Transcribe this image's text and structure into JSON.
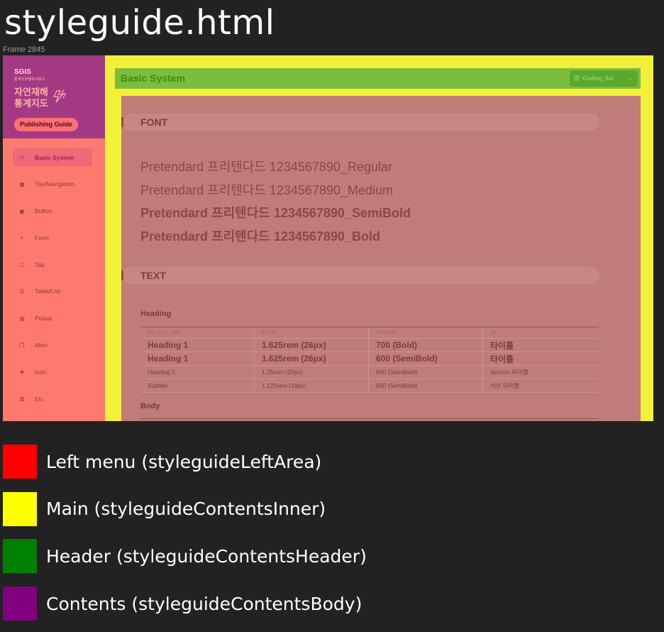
{
  "page": {
    "heading": "styleguide.html",
    "frame_label": "Frame 2845"
  },
  "left": {
    "brand": "SGIS",
    "brand_sub": "통계지리정보서비스",
    "app_title_line1": "자연재해",
    "app_title_line2": "통계지도",
    "publishing_button": "Publishing Guide",
    "menu": [
      {
        "label": "Basic System",
        "icon": "monitor-icon",
        "glyph": "▭",
        "active": true
      },
      {
        "label": "Top/Navigation",
        "icon": "grid-icon",
        "glyph": "▦",
        "active": false
      },
      {
        "label": "Button",
        "icon": "button-icon",
        "glyph": "▣",
        "active": false
      },
      {
        "label": "Form",
        "icon": "toggle-icon",
        "glyph": "◐",
        "active": false
      },
      {
        "label": "Tab",
        "icon": "tab-icon",
        "glyph": "▢",
        "active": false
      },
      {
        "label": "Table/List",
        "icon": "list-icon",
        "glyph": "☰",
        "active": false
      },
      {
        "label": "Popup",
        "icon": "window-icon",
        "glyph": "▤",
        "active": false
      },
      {
        "label": "Alert",
        "icon": "copy-icon",
        "glyph": "❐",
        "active": false
      },
      {
        "label": "Icon",
        "icon": "shapes-icon",
        "glyph": "◈",
        "active": false
      },
      {
        "label": "Etc.",
        "icon": "card-icon",
        "glyph": "▥",
        "active": false
      }
    ]
  },
  "header": {
    "title": "Basic System",
    "coding_button": "Coding_list"
  },
  "content": {
    "font_section": "FONT",
    "font_samples": [
      {
        "text": "Pretendard 프리텐다드 1234567890_Regular",
        "weight": "400"
      },
      {
        "text": "Pretendard 프리텐다드 1234567890_Medium",
        "weight": "500"
      },
      {
        "text": "Pretendard 프리텐다드 1234567890_SemiBold",
        "weight": "600"
      },
      {
        "text": "Pretendard 프리텐다드 1234567890_Bold",
        "weight": "700"
      }
    ],
    "text_section": "TEXT",
    "heading_label": "Heading",
    "table": {
      "headers": [
        "폰트 타이포그래피",
        "font-size",
        "font-weight",
        "용도"
      ],
      "rows": [
        {
          "style": "big",
          "cells": [
            "Heading 1",
            "1.625rem (26px)",
            "700 (Bold)",
            "타이틀"
          ]
        },
        {
          "style": "big",
          "cells": [
            "Heading 1",
            "1.625rem (26px)",
            "600 (SemiBold)",
            "타이틀"
          ]
        },
        {
          "style": "small",
          "cells": [
            "Heading 2",
            "1.25rem (20px)",
            "600 (SemiBold)",
            "Section 타이틀"
          ]
        },
        {
          "style": "small",
          "cells": [
            "Subtitle",
            "1.125rem (18px)",
            "600 (SemiBold)",
            "서브 타이틀"
          ]
        }
      ]
    },
    "body_label": "Body"
  },
  "legend": [
    {
      "color": "#ff0000",
      "label": "Left menu (styleguideLeftArea)"
    },
    {
      "color": "#ffff00",
      "label": "Main (styleguideContentsInner)"
    },
    {
      "color": "#008000",
      "label": "Header (styleguideContentsHeader)"
    },
    {
      "color": "#800080",
      "label": "Contents (styleguideContentsBody)"
    }
  ],
  "colors": {
    "background": "#222222",
    "main_overlay": "#f3f03a",
    "left_overlay": "#ff7a6e",
    "header_overlay": "#7cbd3e",
    "body_overlay": "#bf7c79"
  }
}
